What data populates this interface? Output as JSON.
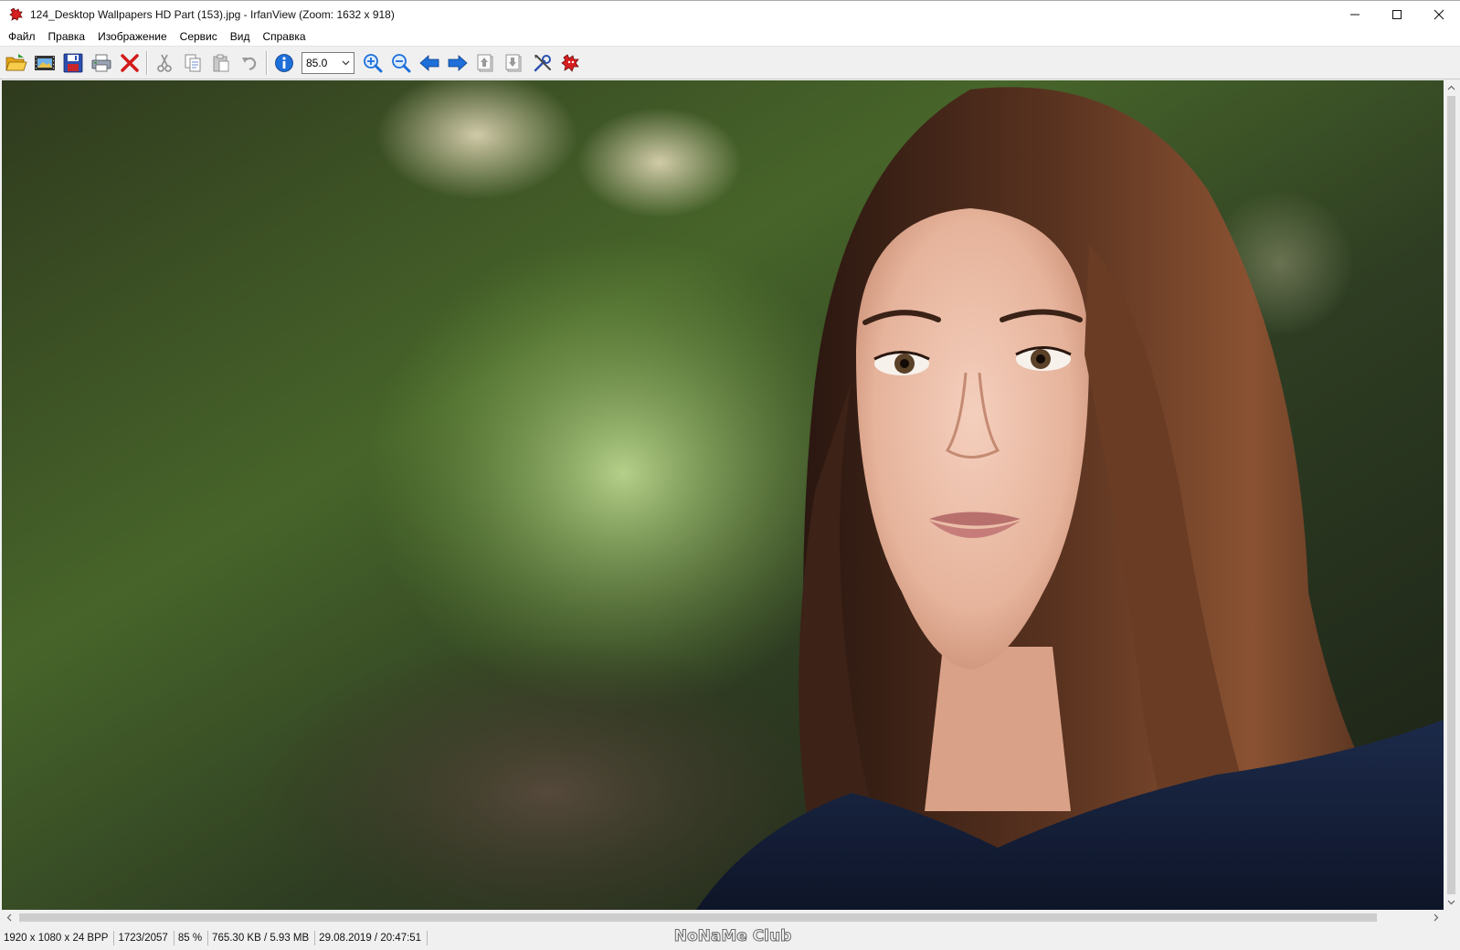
{
  "window": {
    "title": "124_Desktop Wallpapers  HD Part (153).jpg - IrfanView (Zoom: 1632 x 918)",
    "app_icon": "irfanview-cat-icon",
    "controls": [
      "minimize-icon",
      "maximize-icon",
      "close-icon"
    ]
  },
  "menu": {
    "items": [
      "Файл",
      "Правка",
      "Изображение",
      "Сервис",
      "Вид",
      "Справка"
    ]
  },
  "toolbar": {
    "zoom_value": "85.0",
    "buttons": [
      "open-icon",
      "slideshow-icon",
      "save-icon",
      "print-icon",
      "delete-icon",
      "cut-icon",
      "copy-icon",
      "paste-icon",
      "undo-icon",
      "info-icon",
      "zoom-in-icon",
      "zoom-out-icon",
      "prev-icon",
      "next-icon",
      "first-icon",
      "last-icon",
      "settings-icon",
      "about-icon"
    ]
  },
  "statusbar": {
    "dimensions": "1920 x 1080 x 24 BPP",
    "index": "1723/2057",
    "zoom": "85 %",
    "size": "765.30 KB / 5.93 MB",
    "datetime": "29.08.2019 / 20:47:51"
  },
  "watermark": "NoNaMe Club",
  "colors": {
    "accent_blue": "#1e6fd9",
    "delete_red": "#d31b1b",
    "folder_yellow": "#f2b91e"
  }
}
